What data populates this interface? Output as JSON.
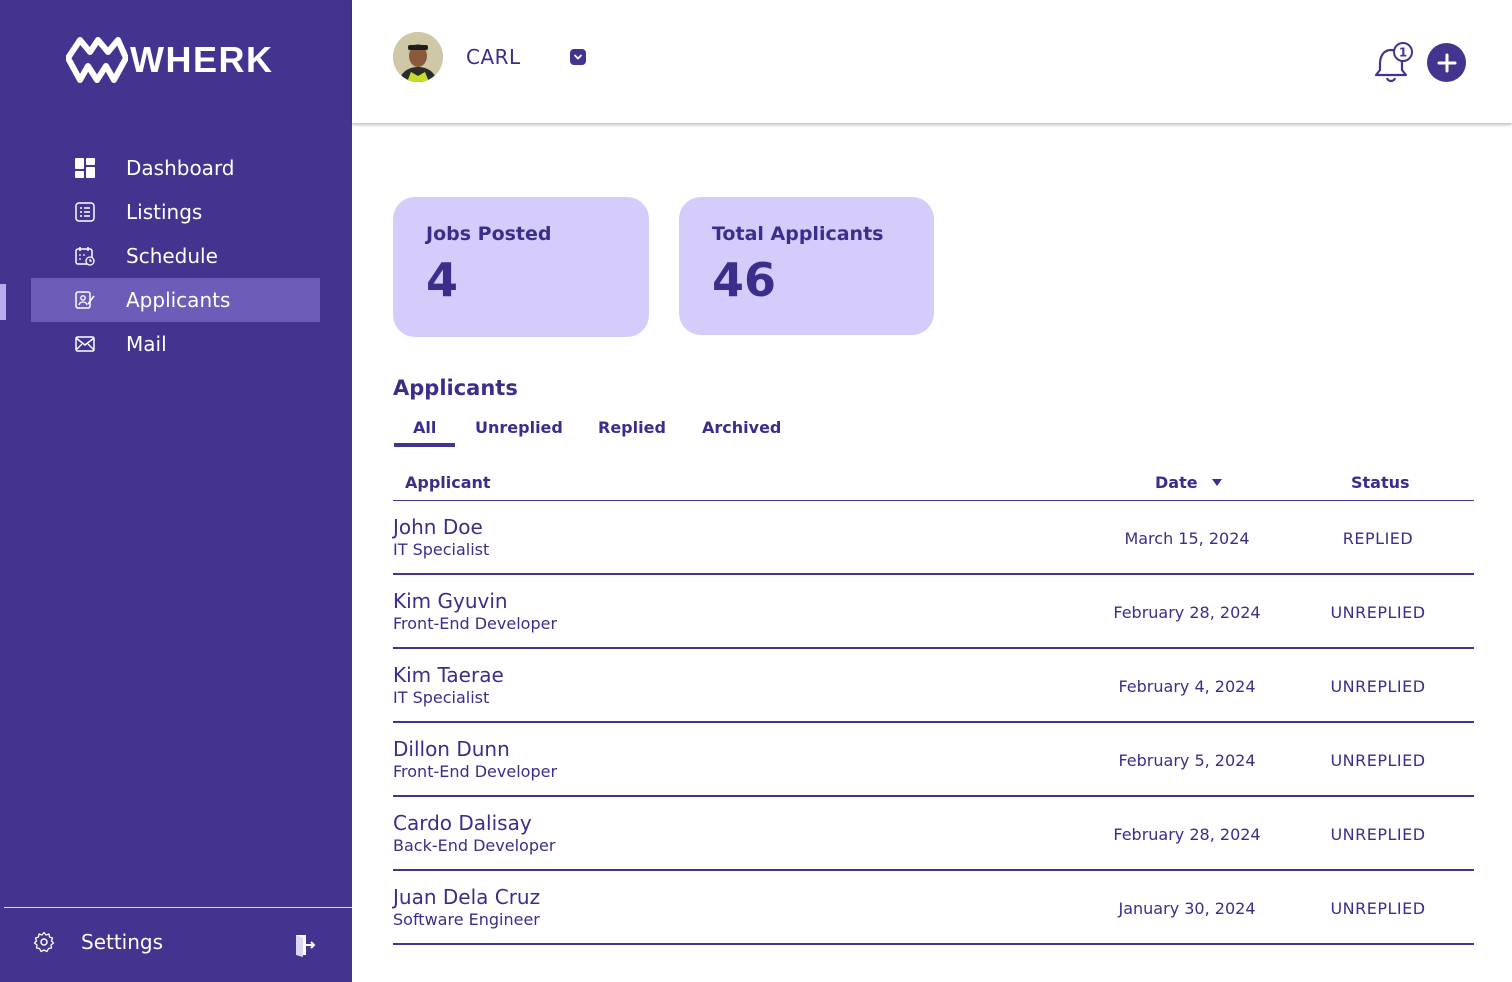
{
  "app": {
    "brand": "WHERK"
  },
  "colors": {
    "primary": "#45348f",
    "active_nav": "#6d5cb8",
    "card_bg": "#d5ccfc",
    "text": "#3d2d8a"
  },
  "sidebar": {
    "items": [
      {
        "label": "Dashboard",
        "icon": "dashboard-icon",
        "active": false
      },
      {
        "label": "Listings",
        "icon": "list-icon",
        "active": false
      },
      {
        "label": "Schedule",
        "icon": "calendar-icon",
        "active": false
      },
      {
        "label": "Applicants",
        "icon": "applicants-icon",
        "active": true
      },
      {
        "label": "Mail",
        "icon": "mail-icon",
        "active": false
      }
    ],
    "settings_label": "Settings"
  },
  "header": {
    "username": "CARL",
    "notification_count": "1"
  },
  "stats": {
    "jobs_posted": {
      "label": "Jobs Posted",
      "value": "4"
    },
    "total_applicants": {
      "label": "Total Applicants",
      "value": "46"
    }
  },
  "applicants": {
    "title": "Applicants",
    "tabs": [
      "All",
      "Unreplied",
      "Replied",
      "Archived"
    ],
    "active_tab": "All",
    "columns": {
      "applicant": "Applicant",
      "date": "Date",
      "status": "Status"
    },
    "rows": [
      {
        "name": "John Doe",
        "role": "IT Specialist",
        "date": "March 15, 2024",
        "status": "REPLIED"
      },
      {
        "name": "Kim Gyuvin",
        "role": "Front-End Developer",
        "date": "February 28, 2024",
        "status": "UNREPLIED"
      },
      {
        "name": "Kim Taerae",
        "role": "IT Specialist",
        "date": "February 4, 2024",
        "status": "UNREPLIED"
      },
      {
        "name": "Dillon Dunn",
        "role": "Front-End Developer",
        "date": "February 5, 2024",
        "status": "UNREPLIED"
      },
      {
        "name": "Cardo Dalisay",
        "role": "Back-End Developer",
        "date": "February 28, 2024",
        "status": "UNREPLIED"
      },
      {
        "name": "Juan Dela Cruz",
        "role": "Software Engineer",
        "date": "January 30, 2024",
        "status": "UNREPLIED"
      }
    ]
  }
}
